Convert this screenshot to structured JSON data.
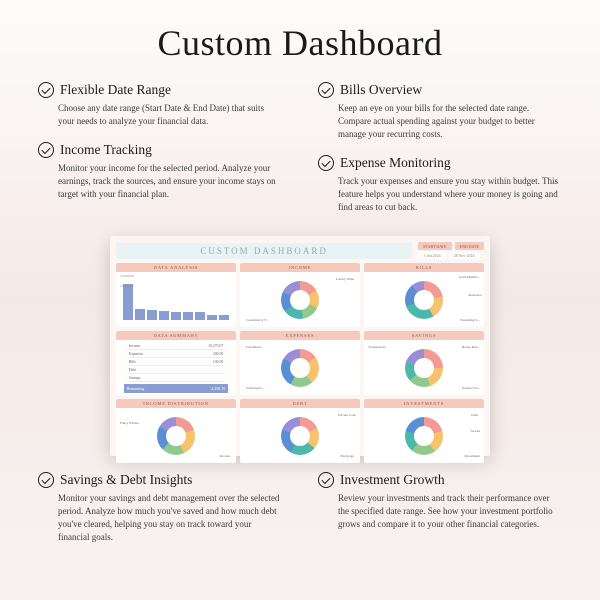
{
  "title": "Custom Dashboard",
  "features": {
    "left": [
      {
        "h": "Flexible Date Range",
        "d": "Choose any date range (Start Date & End Date) that suits your needs to analyze your financial data."
      },
      {
        "h": "Income Tracking",
        "d": "Monitor your income for the selected period. Analyze your earnings, track the sources, and ensure your income stays on target with your financial plan."
      }
    ],
    "right": [
      {
        "h": "Bills Overview",
        "d": "Keep an eye on your bills for the selected date range. Compare actual spending against your budget to better manage your recurring costs."
      },
      {
        "h": "Expense Monitoring",
        "d": "Track your expenses and ensure you stay within budget. This feature helps you understand where your money is going and find areas to cut back."
      }
    ],
    "bottomLeft": {
      "h": "Savings & Debt Insights",
      "d": "Monitor your savings and debt management over the selected period. Analyze how much you've saved and how much debt you've cleared, helping you stay on track toward your financial goals."
    },
    "bottomRight": {
      "h": "Investment Growth",
      "d": "Review your investments and track their performance over the specified date range. See how your investment portfolio grows and compare it to your other financial categories."
    }
  },
  "screenshot": {
    "title": "CUSTOM DASHBOARD",
    "startLabel": "START DATE",
    "endLabel": "END DATE",
    "startVal": "1 Jan 2024",
    "endVal": "28 Nov 2024",
    "cards": {
      "dataAnalysis": "DATA ANALYSIS",
      "income": "INCOME",
      "bills": "BILLS",
      "dataSummary": "DATA SUMMARY",
      "expenses": "EXPENSES",
      "savings": "SAVINGS",
      "incomeDist": "INCOME DISTRIBUTION",
      "debt": "DEBT",
      "investments": "INVESTMENTS"
    },
    "axis": [
      "12,000.00",
      "10,000.00"
    ],
    "summaryRows": [
      [
        "Income",
        "10,270.07"
      ],
      [
        "Expenses",
        "200.00"
      ],
      [
        "Bills",
        "100.00"
      ],
      [
        "Debt",
        ""
      ],
      [
        "Savings",
        ""
      ]
    ],
    "summaryFoot": [
      "Remaining",
      "2,250.19"
    ],
    "labels": {
      "income": [
        "Lottery Wins",
        "Consultancy F..."
      ],
      "bills": [
        "Gym Membe...",
        "Insurance",
        "Streaming S..."
      ],
      "expenses": [
        "Fun Mone...",
        "Subscriptio..."
      ],
      "savings": [
        "Transportati...",
        "House Ren...",
        "General Sa..."
      ],
      "incomeDist": [
        "Fancy Exam...",
        "Income"
      ],
      "debt": [
        "Private Loan",
        "Mortgage"
      ],
      "investments": [
        "Gifts",
        "Stocks",
        "Investment"
      ]
    }
  }
}
